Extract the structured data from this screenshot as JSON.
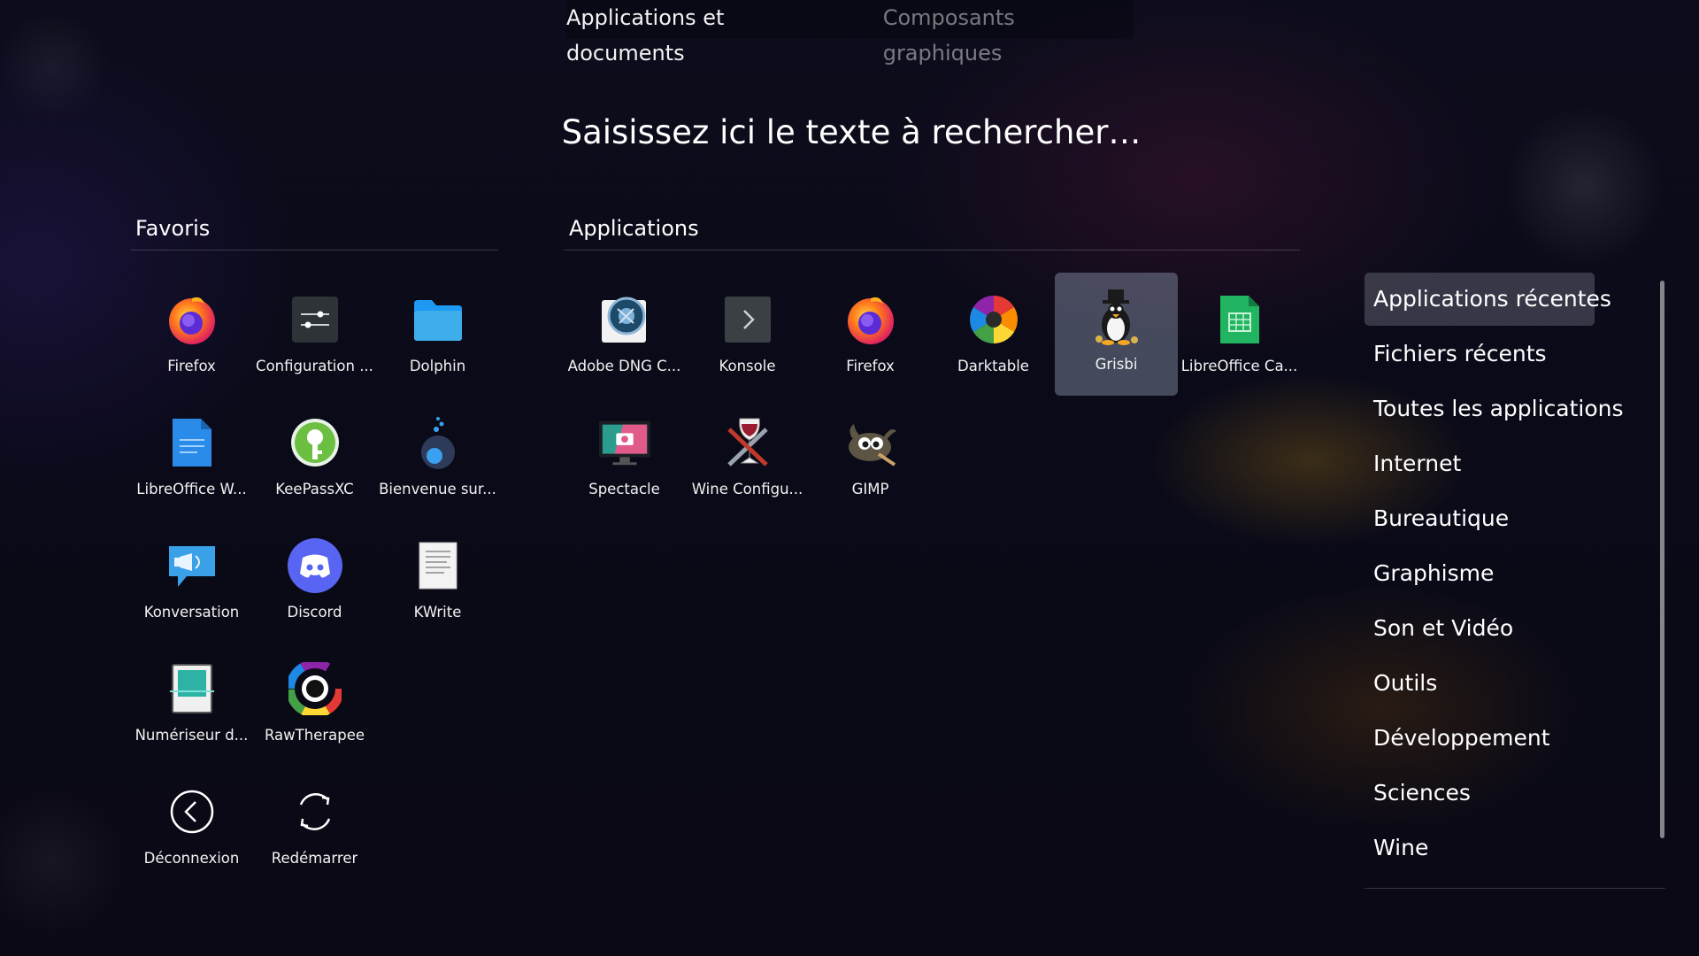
{
  "tabs": [
    {
      "label": "Applications et documents",
      "active": true
    },
    {
      "label": "Composants graphiques",
      "active": false
    }
  ],
  "search": {
    "placeholder": "Saisissez ici le texte à rechercher…"
  },
  "favorites": {
    "title": "Favoris",
    "items": [
      {
        "label": "Firefox",
        "icon": "firefox-icon"
      },
      {
        "label": "Configuration ...",
        "icon": "system-settings-icon"
      },
      {
        "label": "Dolphin",
        "icon": "dolphin-folder-icon"
      },
      {
        "label": "LibreOffice W...",
        "icon": "libreoffice-writer-icon"
      },
      {
        "label": "KeePassXC",
        "icon": "keepassxc-icon"
      },
      {
        "label": "Bienvenue sur...",
        "icon": "welcome-icon"
      },
      {
        "label": "Konversation",
        "icon": "konversation-icon"
      },
      {
        "label": "Discord",
        "icon": "discord-icon"
      },
      {
        "label": "KWrite",
        "icon": "kwrite-icon"
      },
      {
        "label": "Numériseur d...",
        "icon": "scanner-icon"
      },
      {
        "label": "RawTherapee",
        "icon": "rawtherapee-icon"
      },
      {
        "label": "Déconnexion",
        "icon": "logout-icon"
      },
      {
        "label": "Redémarrer",
        "icon": "restart-icon"
      }
    ]
  },
  "applications": {
    "title": "Applications",
    "items": [
      {
        "label": "Adobe DNG C...",
        "icon": "adobe-dng-converter-icon"
      },
      {
        "label": "Konsole",
        "icon": "konsole-icon"
      },
      {
        "label": "Firefox",
        "icon": "firefox-icon"
      },
      {
        "label": "Darktable",
        "icon": "darktable-icon"
      },
      {
        "label": "Grisbi",
        "icon": "grisbi-icon",
        "selected": true
      },
      {
        "label": "LibreOffice Ca...",
        "icon": "libreoffice-calc-icon"
      },
      {
        "label": "Spectacle",
        "icon": "spectacle-icon"
      },
      {
        "label": "Wine Configu...",
        "icon": "wine-config-icon"
      },
      {
        "label": "GIMP",
        "icon": "gimp-icon"
      }
    ]
  },
  "categories": [
    {
      "label": "Applications récentes",
      "selected": true
    },
    {
      "label": "Fichiers récents"
    },
    {
      "label": "Toutes les applications"
    },
    {
      "label": "Internet"
    },
    {
      "label": "Bureautique"
    },
    {
      "label": "Graphisme"
    },
    {
      "label": "Son et Vidéo"
    },
    {
      "label": "Outils"
    },
    {
      "label": "Développement"
    },
    {
      "label": "Sciences"
    },
    {
      "label": "Wine"
    }
  ]
}
